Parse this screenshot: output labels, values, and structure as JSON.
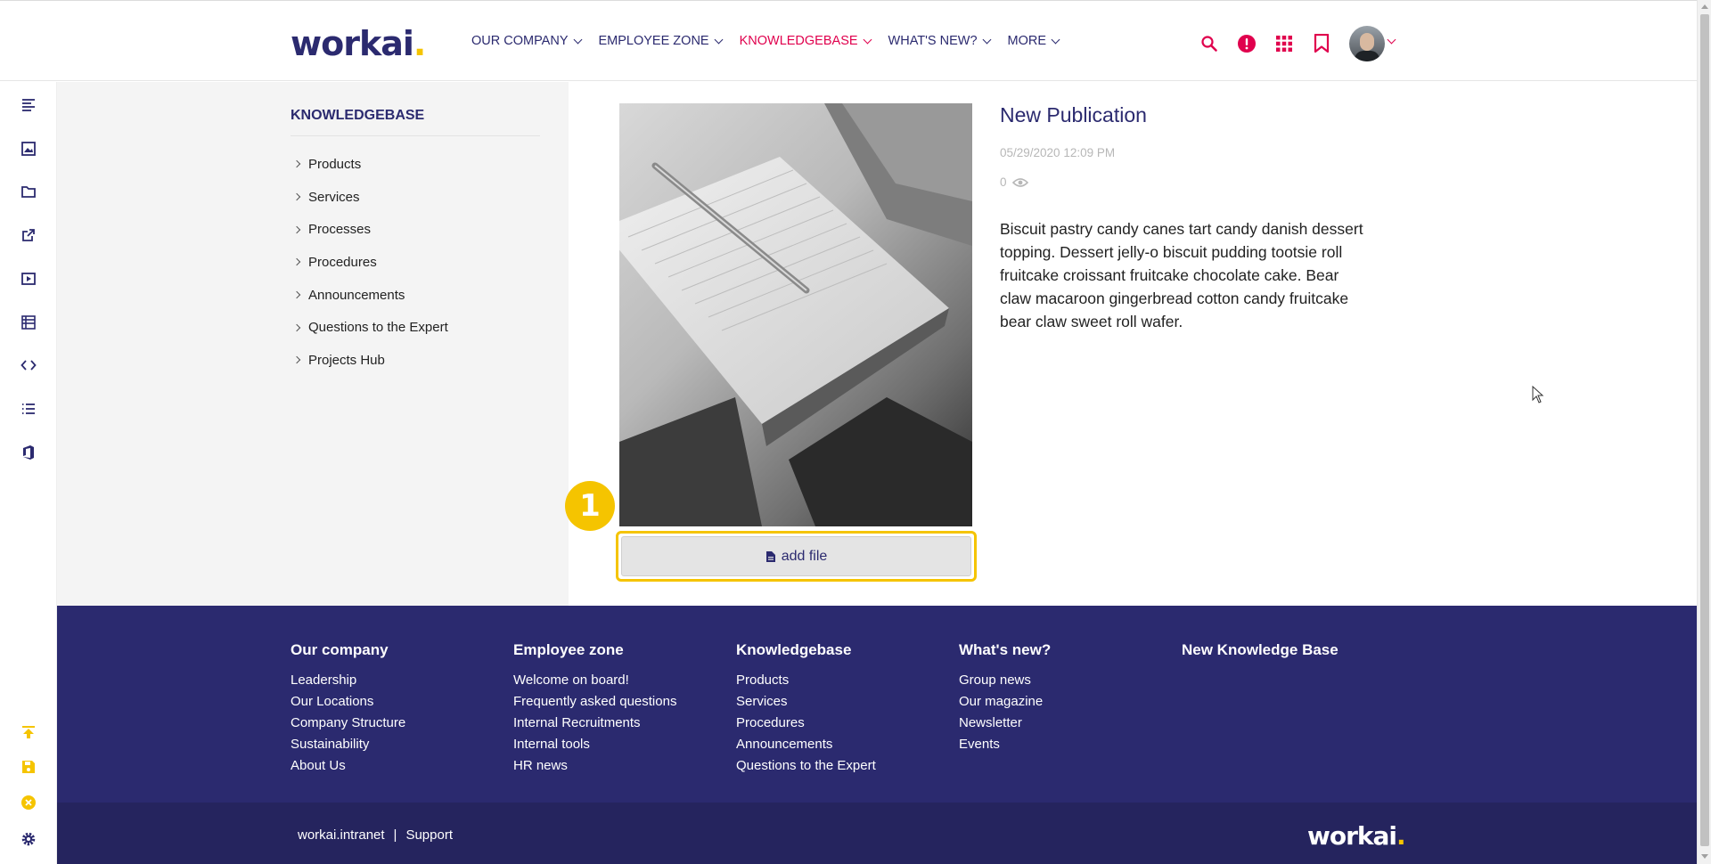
{
  "header": {
    "logo_text": "workai",
    "logo_dot": ".",
    "nav": [
      {
        "label": "OUR COMPANY"
      },
      {
        "label": "EMPLOYEE ZONE"
      },
      {
        "label": "KNOWLEDGEBASE"
      },
      {
        "label": "WHAT'S NEW?"
      },
      {
        "label": "MORE"
      }
    ],
    "active_nav": "KNOWLEDGEBASE",
    "icons": [
      "search-icon",
      "alert-icon",
      "apps-grid-icon",
      "bookmark-icon",
      "avatar"
    ]
  },
  "toolbar": {
    "icons": [
      "align-left-icon",
      "image-icon",
      "folder-icon",
      "external-link-icon",
      "video-icon",
      "table-icon",
      "code-icon",
      "list-icon",
      "office-icon"
    ],
    "bottom_icons": [
      "publish-icon",
      "save-icon",
      "close-icon",
      "settings-icon"
    ]
  },
  "knowledgebase": {
    "title": "KNOWLEDGEBASE",
    "items": [
      {
        "label": "Products"
      },
      {
        "label": "Services"
      },
      {
        "label": "Processes"
      },
      {
        "label": "Procedures"
      },
      {
        "label": "Announcements"
      },
      {
        "label": "Questions to the Expert"
      },
      {
        "label": "Projects Hub"
      }
    ]
  },
  "publication": {
    "title": "New Publication",
    "date": "05/29/2020 12:09 PM",
    "views": "0",
    "body": "Biscuit pastry candy canes tart candy danish dessert topping. Dessert jelly-o biscuit pudding tootsie roll fruitcake croissant fruitcake chocolate cake. Bear claw macaroon gingerbread cotton candy fruitcake bear claw sweet roll wafer.",
    "add_file_label": "add file",
    "step_badge": "1"
  },
  "footer": {
    "columns": [
      {
        "title": "Our company",
        "links": [
          "Leadership",
          "Our Locations",
          "Company Structure",
          "Sustainability",
          "About Us"
        ]
      },
      {
        "title": "Employee zone",
        "links": [
          "Welcome on board!",
          "Frequently asked questions",
          "Internal Recruitments",
          "Internal tools",
          "HR news"
        ]
      },
      {
        "title": "Knowledgebase",
        "links": [
          "Products",
          "Services",
          "Procedures",
          "Announcements",
          "Questions to the Expert"
        ]
      },
      {
        "title": "What's new?",
        "links": [
          "Group news",
          "Our magazine",
          "Newsletter",
          "Events"
        ]
      },
      {
        "title": "New Knowledge Base",
        "links": []
      }
    ],
    "bottom_link_1": "workai.intranet",
    "bottom_sep": "|",
    "bottom_link_2": "Support",
    "logo_text": "workai",
    "logo_dot": "."
  },
  "colors": {
    "brand": "#2b2a6f",
    "accent": "#e0004d",
    "highlight": "#f5c400"
  }
}
